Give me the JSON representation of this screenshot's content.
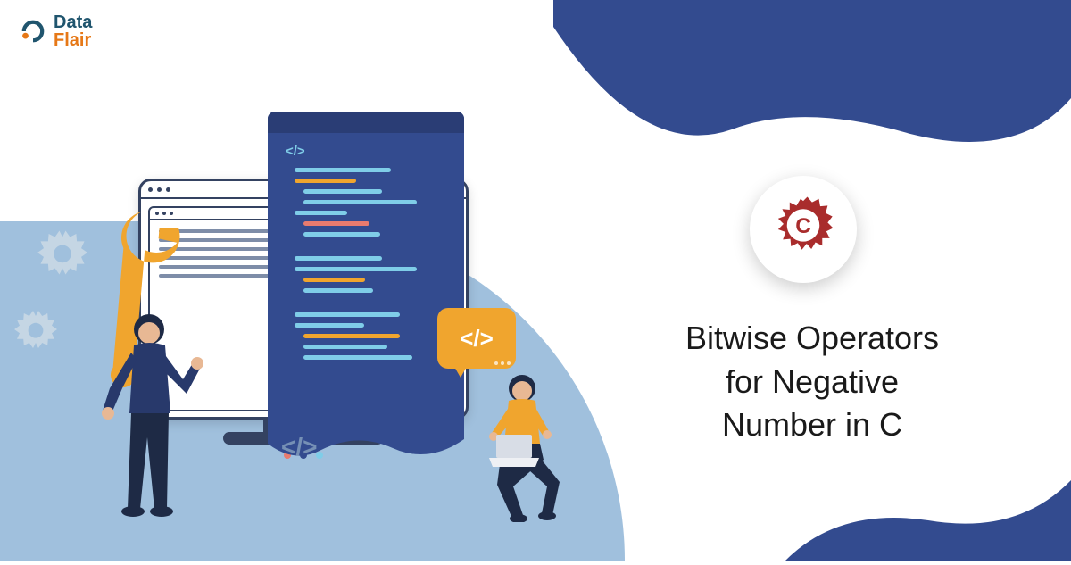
{
  "logo": {
    "line1": "Data",
    "line2": "Flair"
  },
  "title": {
    "line1": "Bitwise Operators",
    "line2": "for Negative",
    "line3": "Number in C"
  },
  "badge_letter": "C",
  "code_symbols": {
    "top": "</>",
    "bubble": "</>",
    "floor": "</>"
  },
  "colors": {
    "wave": "#334b8f",
    "accent": "#f0a52e",
    "badge_red": "#a92c2c",
    "light_blue": "#a0c0dd"
  }
}
